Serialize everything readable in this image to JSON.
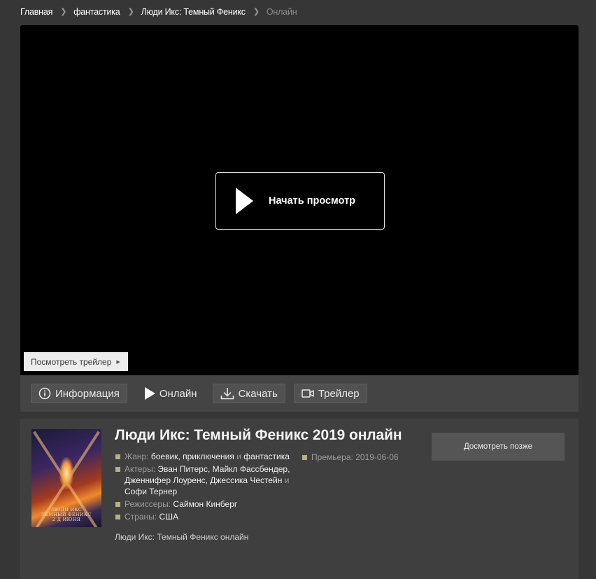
{
  "breadcrumb": {
    "items": [
      "Главная",
      "фантастика",
      "Люди Икс: Темный Феникс"
    ],
    "current": "Онлайн"
  },
  "player": {
    "start_label": "Начать просмотр",
    "trailer_label": "Посмотреть трейлер"
  },
  "tabs": {
    "info": "Информация",
    "online": "Онлайн",
    "download": "Скачать",
    "trailer": "Трейлер"
  },
  "movie": {
    "title": "Люди Икс: Темный Феникс 2019 онлайн",
    "poster_text": [
      "ЛЮДИ ИКС",
      "ТЕМНЫЙ ФЕНИКС",
      "2 Д ИЮНЯ"
    ],
    "genre_label": "Жанр:",
    "genres": [
      "боевик",
      "приключения",
      "фантастика"
    ],
    "actors_label": "Актеры:",
    "actors": [
      "Эван Питерс",
      "Майкл Фассбендер",
      "Дженнифер Лоуренс",
      "Джессика Честейн",
      "Софи Тернер"
    ],
    "directors_label": "Режиссеры:",
    "directors": [
      "Саймон Кинберг"
    ],
    "countries_label": "Страны:",
    "countries": [
      "США"
    ],
    "premiere_label": "Премьера:",
    "premiere": "2019-06-06",
    "watch_later": "Досмотреть позже",
    "online_note": "Люди Икс: Темный Феникс онлайн",
    "joiners": {
      "comma": ",",
      "and": "и"
    }
  },
  "colors": {
    "background": "#363636",
    "player": "#000000",
    "bullet": "#b8ae87"
  }
}
